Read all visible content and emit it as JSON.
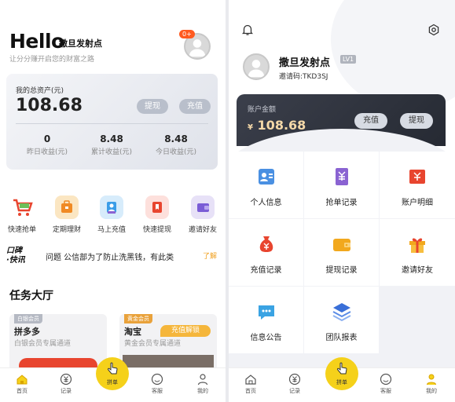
{
  "left": {
    "greeting": "Hello",
    "username": "撒旦发射点",
    "subtitle": "让分分赚开启您的财富之路",
    "notification_badge": "0+",
    "assets": {
      "label": "我的总资产(元)",
      "value": "108.68",
      "withdraw_label": "提现",
      "recharge_label": "充值",
      "stats": [
        {
          "value": "0",
          "label": "昨日收益(元)"
        },
        {
          "value": "8.48",
          "label": "累计收益(元)"
        },
        {
          "value": "8.48",
          "label": "今日收益(元)"
        }
      ]
    },
    "quick_actions": [
      {
        "label": "快速抢单",
        "icon": "shopping-cart-icon"
      },
      {
        "label": "定期理财",
        "icon": "briefcase-icon"
      },
      {
        "label": "马上充值",
        "icon": "user-card-icon"
      },
      {
        "label": "快速提现",
        "icon": "bookmark-icon"
      },
      {
        "label": "邀请好友",
        "icon": "wallet-icon"
      }
    ],
    "ticker": {
      "logo_line1": "口碑",
      "logo_line2": "·快讯",
      "text": "问题 公信部为了防止洗黑钱，有此类",
      "more": "了解"
    },
    "tasks_title": "任务大厅",
    "tasks": [
      {
        "tag": "白银会员",
        "name": "拼多多",
        "desc": "白银会员专属通道",
        "tag_color": "#b5b9c3"
      },
      {
        "tag": "黄金会员",
        "name": "淘宝",
        "desc": "黄金会员专属通道",
        "unlock": "充值解锁",
        "tag_color": "#e9a23b"
      }
    ]
  },
  "right": {
    "username": "撒旦发射点",
    "level": "LV1",
    "invite_code": "邀请码:TKD3SJ",
    "balance_label": "账户金额",
    "currency": "¥",
    "balance_value": "108.68",
    "recharge_label": "充值",
    "withdraw_label": "提现",
    "menu": [
      {
        "label": "个人信息",
        "icon": "id-card-icon",
        "color": "#4a90e2"
      },
      {
        "label": "抢单记录",
        "icon": "yen-document-icon",
        "color": "#8a63d2"
      },
      {
        "label": "账户明细",
        "icon": "yen-ticket-icon",
        "color": "#e8452f"
      },
      {
        "label": "充值记录",
        "icon": "money-bag-icon",
        "color": "#e8452f"
      },
      {
        "label": "提现记录",
        "icon": "wallet-icon",
        "color": "#f2a81d"
      },
      {
        "label": "邀请好友",
        "icon": "gift-icon",
        "color": "#f2a81d"
      },
      {
        "label": "信息公告",
        "icon": "message-icon",
        "color": "#3aa3e3"
      },
      {
        "label": "团队报表",
        "icon": "layers-icon",
        "color": "#3a6fd8"
      }
    ]
  },
  "tabbar": {
    "home": "首页",
    "records": "记录",
    "center": "拼单",
    "service": "客服",
    "mine": "我的"
  }
}
